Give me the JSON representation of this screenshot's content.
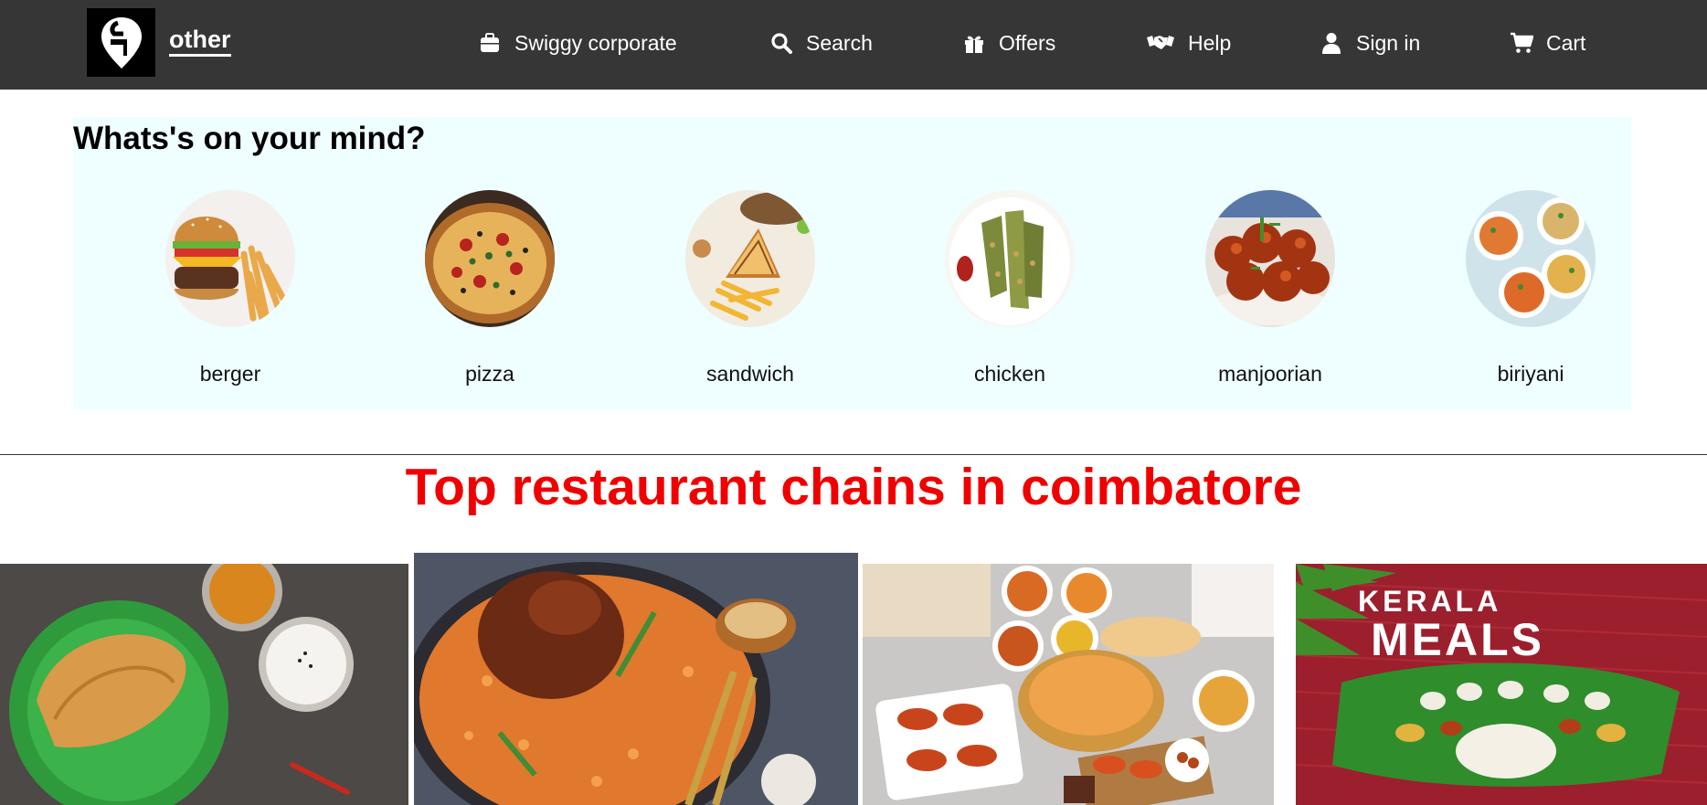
{
  "header": {
    "brand": "other",
    "nav": [
      {
        "label": "Swiggy corporate",
        "icon": "briefcase-icon"
      },
      {
        "label": "Search",
        "icon": "search-icon"
      },
      {
        "label": "Offers",
        "icon": "gift-icon"
      },
      {
        "label": "Help",
        "icon": "handshake-icon"
      },
      {
        "label": "Sign in",
        "icon": "user-icon"
      },
      {
        "label": "Cart",
        "icon": "cart-icon"
      }
    ]
  },
  "mind": {
    "title": "Whats's on your mind?",
    "items": [
      {
        "label": "berger"
      },
      {
        "label": "pizza"
      },
      {
        "label": "sandwich"
      },
      {
        "label": "chicken"
      },
      {
        "label": "manjoorian"
      },
      {
        "label": "biriyani"
      }
    ]
  },
  "chains": {
    "title": "Top restaurant chains in coimbatore",
    "cards": [
      {
        "image": "dosa-image"
      },
      {
        "image": "chicken-biryani-image"
      },
      {
        "image": "platter-image"
      },
      {
        "image": "kerala-meals-image",
        "text": "KERALA MEALS"
      }
    ]
  },
  "colors": {
    "header_bg": "#363636",
    "mind_bg": "#effefe",
    "title_red": "#f00000"
  }
}
